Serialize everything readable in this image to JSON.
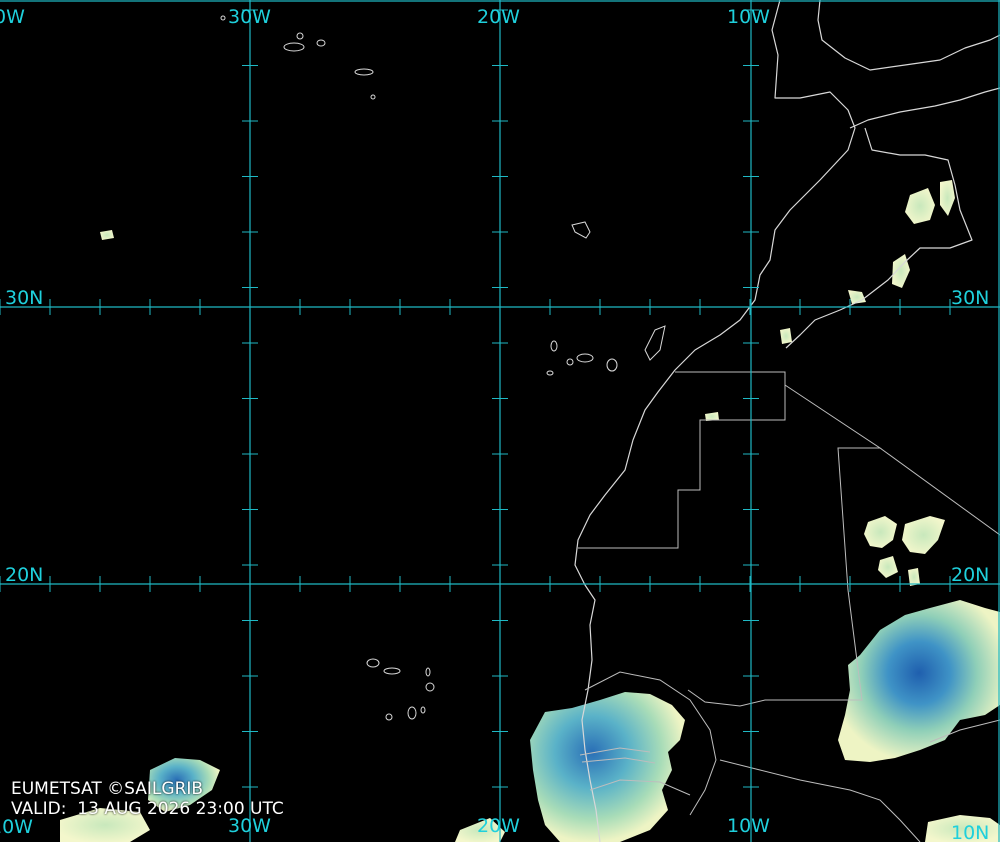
{
  "image": {
    "credit": "EUMETSAT ©SAILGRIB",
    "valid_label": "VALID:",
    "valid_time": "13 AUG 2026 23:00 UTC"
  },
  "grid": {
    "lon_labels": [
      "0W",
      "30W",
      "20W",
      "10W"
    ],
    "lon_labels_bottom": [
      "10W",
      "30W",
      "20W",
      "10W",
      "10N"
    ],
    "lat_labels_left": [
      "30N",
      "20N"
    ],
    "lat_labels_right": [
      "30N",
      "20N"
    ]
  },
  "colors": {
    "grid": "#1fb8c4",
    "coast": "#d8d8d8",
    "cloud_light": "#f2f5c8",
    "cloud_mid": "#8fcfb8",
    "cloud_deep": "#2a6fb6"
  }
}
